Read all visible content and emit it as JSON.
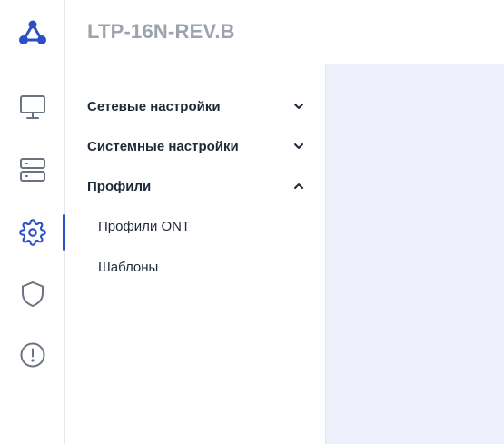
{
  "header": {
    "device_name": "LTP-16N-REV.B",
    "logo_icon": "network-nodes-icon",
    "brand_color": "#2c4fc7"
  },
  "rail": {
    "items": [
      {
        "icon": "monitor-icon",
        "active": false
      },
      {
        "icon": "server-icon",
        "active": false
      },
      {
        "icon": "gear-icon",
        "active": true
      },
      {
        "icon": "shield-icon",
        "active": false
      },
      {
        "icon": "alert-circle-icon",
        "active": false
      }
    ]
  },
  "menu": {
    "sections": [
      {
        "label": "Сетевые настройки",
        "expanded": false
      },
      {
        "label": "Системные настройки",
        "expanded": false
      },
      {
        "label": "Профили",
        "expanded": true,
        "children": [
          {
            "label": "Профили ONT"
          },
          {
            "label": "Шаблоны"
          }
        ]
      }
    ]
  },
  "colors": {
    "accent": "#2c4fc7",
    "content_bg": "#eef1fb",
    "icon_gray": "#6b7280",
    "title_gray": "#9ca3af"
  }
}
